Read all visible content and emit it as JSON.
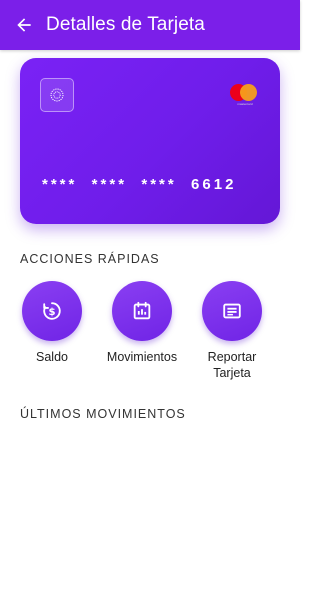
{
  "appbar": {
    "title": "Detalles de Tarjeta",
    "back_icon": "arrow-left-icon",
    "background": "#7b1fe9"
  },
  "card": {
    "masked_number": "****  ****  ****  6612",
    "chip_icon": "chip-icon",
    "brand_icon": "mastercard-logo",
    "brand_logo_text": "mastercard",
    "gradient_start": "#7a22f5",
    "gradient_end": "#6417d6"
  },
  "quick_actions": {
    "title": "ACCIONES RÁPIDAS",
    "items": [
      {
        "label": "Saldo",
        "icon": "dollar-refresh-icon"
      },
      {
        "label": "Movimientos",
        "icon": "calendar-chart-icon"
      },
      {
        "label": "Reportar\nTarjeta",
        "icon": "report-card-icon"
      }
    ]
  },
  "recent_movements": {
    "title": "ÚLTIMOS MOVIMIENTOS"
  }
}
